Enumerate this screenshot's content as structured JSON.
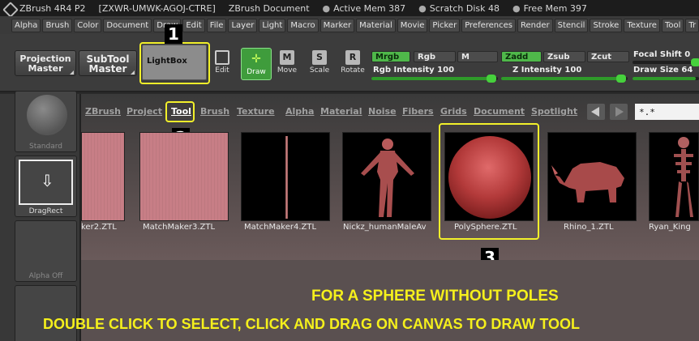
{
  "titlebar": {
    "app": "ZBrush 4R4 P2",
    "license": "[ZXWR-UMWK-AGOJ-CTRE]",
    "document": "ZBrush Document",
    "active_mem": "Active Mem 387",
    "scratch_disk": "Scratch Disk 48",
    "free_mem": "Free Mem 397"
  },
  "menu": [
    "Alpha",
    "Brush",
    "Color",
    "Document",
    "Draw",
    "Edit",
    "File",
    "Layer",
    "Light",
    "Macro",
    "Marker",
    "Material",
    "Movie",
    "Picker",
    "Preferences",
    "Render",
    "Stencil",
    "Stroke",
    "Texture",
    "Tool",
    "Tr"
  ],
  "toolbar": {
    "projection_master": "Projection\nMaster",
    "subtool_master": "SubTool\nMaster",
    "lightbox": "LightBox",
    "edit": "Edit",
    "draw": "Draw",
    "move": "Move",
    "scale": "Scale",
    "rotate": "Rotate",
    "move_glyph": "M",
    "scale_glyph": "S",
    "rotate_glyph": "R",
    "mrgb": "Mrgb",
    "rgb": "Rgb",
    "m": "M",
    "zadd": "Zadd",
    "zsub": "Zsub",
    "zcut": "Zcut",
    "rgb_intensity": "Rgb Intensity 100",
    "z_intensity": "Z Intensity 100",
    "focal_shift": "Focal Shift 0",
    "draw_size": "Draw Size 64"
  },
  "left_shelf": {
    "standard": "Standard",
    "dragrect": "DragRect",
    "alpha_off": "Alpha Off"
  },
  "lightbox": {
    "tabs": [
      "ZBrush",
      "Project",
      "Tool",
      "Brush",
      "Texture",
      "Alpha",
      "Material",
      "Noise",
      "Fibers",
      "Grids",
      "Document",
      "Spotlight"
    ],
    "active_tab": "Tool",
    "filter_value": "*.*",
    "items": [
      {
        "label": "ker2.ZTL"
      },
      {
        "label": "MatchMaker3.ZTL"
      },
      {
        "label": "MatchMaker4.ZTL"
      },
      {
        "label": "Nickz_humanMaleAv"
      },
      {
        "label": "PolySphere.ZTL"
      },
      {
        "label": "Rhino_1.ZTL"
      },
      {
        "label": "Ryan_King"
      }
    ]
  },
  "callouts": {
    "one": "1",
    "two": "2",
    "three": "3",
    "line1": "FOR A SPHERE WITHOUT POLES",
    "line2": "DOUBLE CLICK TO SELECT, CLICK AND DRAG ON CANVAS TO DRAW TOOL"
  },
  "colors": {
    "highlight": "#f2f02a",
    "active_green": "#4fb84a",
    "overlay_text": "#f5f01c"
  }
}
